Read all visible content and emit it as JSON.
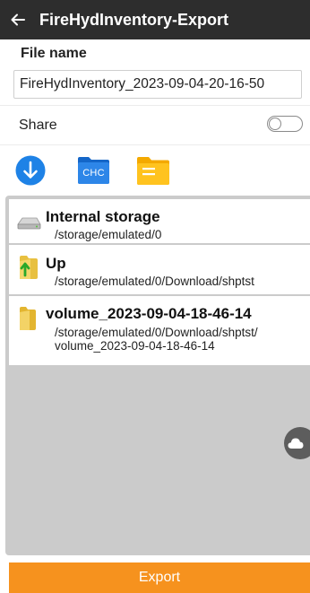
{
  "header": {
    "title": "FireHydInventory-Export",
    "back_icon": "arrow-left-icon"
  },
  "file_name": {
    "label": "File name",
    "value": "FireHydInventory_2023-09-04-20-16-50"
  },
  "share": {
    "label": "Share",
    "enabled": false
  },
  "toolbar": {
    "download_icon": "download-circle-icon",
    "chc_folder_label": "CHC",
    "folder_icon": "yellow-folder-icon"
  },
  "file_list": [
    {
      "icon": "drive-icon",
      "title": "Internal storage",
      "path": "/storage/emulated/0"
    },
    {
      "icon": "folder-up-icon",
      "title": "Up",
      "path": "/storage/emulated/0/Download/shptst"
    },
    {
      "icon": "folder-icon",
      "title": "volume_2023-09-04-18-46-14",
      "path_lines": [
        "/storage/emulated/0/Download/shptst/",
        "volume_2023-09-04-18-46-14"
      ]
    }
  ],
  "export_label": "Export",
  "colors": {
    "header_bg": "#2d2d2d",
    "accent_orange": "#f6921e",
    "blue": "#1e82e6",
    "folder_yellow": "#ffc107"
  }
}
